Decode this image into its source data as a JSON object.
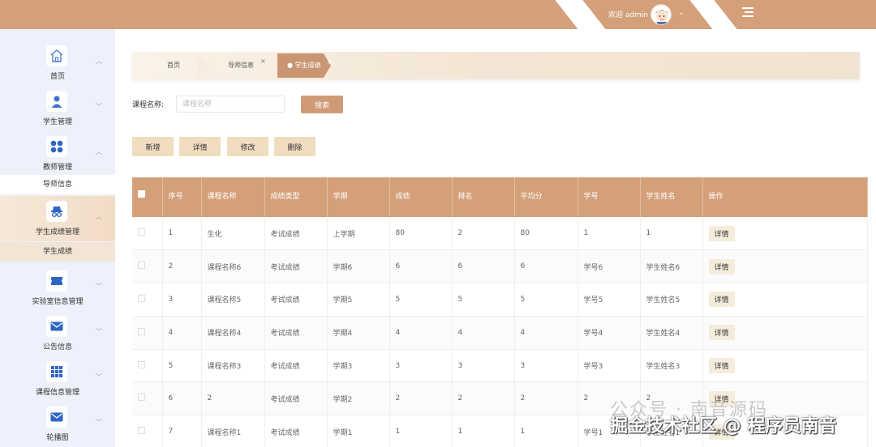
{
  "header": {
    "welcome": "欢迎 admin",
    "chevron": "⌄"
  },
  "sidebar": {
    "items": [
      {
        "label": "首页",
        "icon": "home-icon"
      },
      {
        "label": "学生管理",
        "icon": "user-icon"
      },
      {
        "label": "教师管理",
        "icon": "grid-dots-icon",
        "sub": "导师信息"
      },
      {
        "label": "学生成绩管理",
        "icon": "detective-icon",
        "sub": "学生成绩"
      },
      {
        "label": "实验室信息管理",
        "icon": "ticket-icon"
      },
      {
        "label": "公告信息",
        "icon": "mail-icon"
      },
      {
        "label": "课程信息管理",
        "icon": "apps-icon"
      },
      {
        "label": "轮播图",
        "icon": "mail-icon"
      }
    ]
  },
  "breadcrumb": {
    "home": "首页",
    "tab1": "导师信息",
    "active": "● 学生成绩",
    "close": "×"
  },
  "search": {
    "label": "课程名称:",
    "placeholder": "课程名称",
    "button": "搜索"
  },
  "actions": {
    "add": "新增",
    "detail": "详情",
    "edit": "修改",
    "delete": "删除"
  },
  "table": {
    "headers": [
      "序号",
      "课程名称",
      "成绩类型",
      "学期",
      "成绩",
      "排名",
      "平均分",
      "学号",
      "学生姓名",
      "操作"
    ],
    "detail_label": "详情",
    "rows": [
      [
        "1",
        "生化",
        "考试成绩",
        "上学期",
        "80",
        "2",
        "80",
        "1",
        "1"
      ],
      [
        "2",
        "课程名称6",
        "考试成绩",
        "学期6",
        "6",
        "6",
        "6",
        "学号6",
        "学生姓名6"
      ],
      [
        "3",
        "课程名称5",
        "考试成绩",
        "学期5",
        "5",
        "5",
        "5",
        "学号5",
        "学生姓名5"
      ],
      [
        "4",
        "课程名称4",
        "考试成绩",
        "学期4",
        "4",
        "4",
        "4",
        "学号4",
        "学生姓名4"
      ],
      [
        "5",
        "课程名称3",
        "考试成绩",
        "学期3",
        "3",
        "3",
        "3",
        "学号3",
        "学生姓名3"
      ],
      [
        "6",
        "2",
        "考试成绩",
        "学期2",
        "2",
        "2",
        "2",
        "2",
        "2"
      ],
      [
        "7",
        "课程名称1",
        "考试成绩",
        "学期1",
        "1",
        "1",
        "1",
        "学号1",
        "学生姓名1"
      ]
    ]
  },
  "watermark": {
    "line1": "公众号 · 南音源码",
    "line2": "掘金技术社区 @ 程序员南音"
  },
  "colors": {
    "accent": "#d4a07a",
    "button_light": "#f0ddc0",
    "sidebar_bg": "#eef1fb"
  }
}
